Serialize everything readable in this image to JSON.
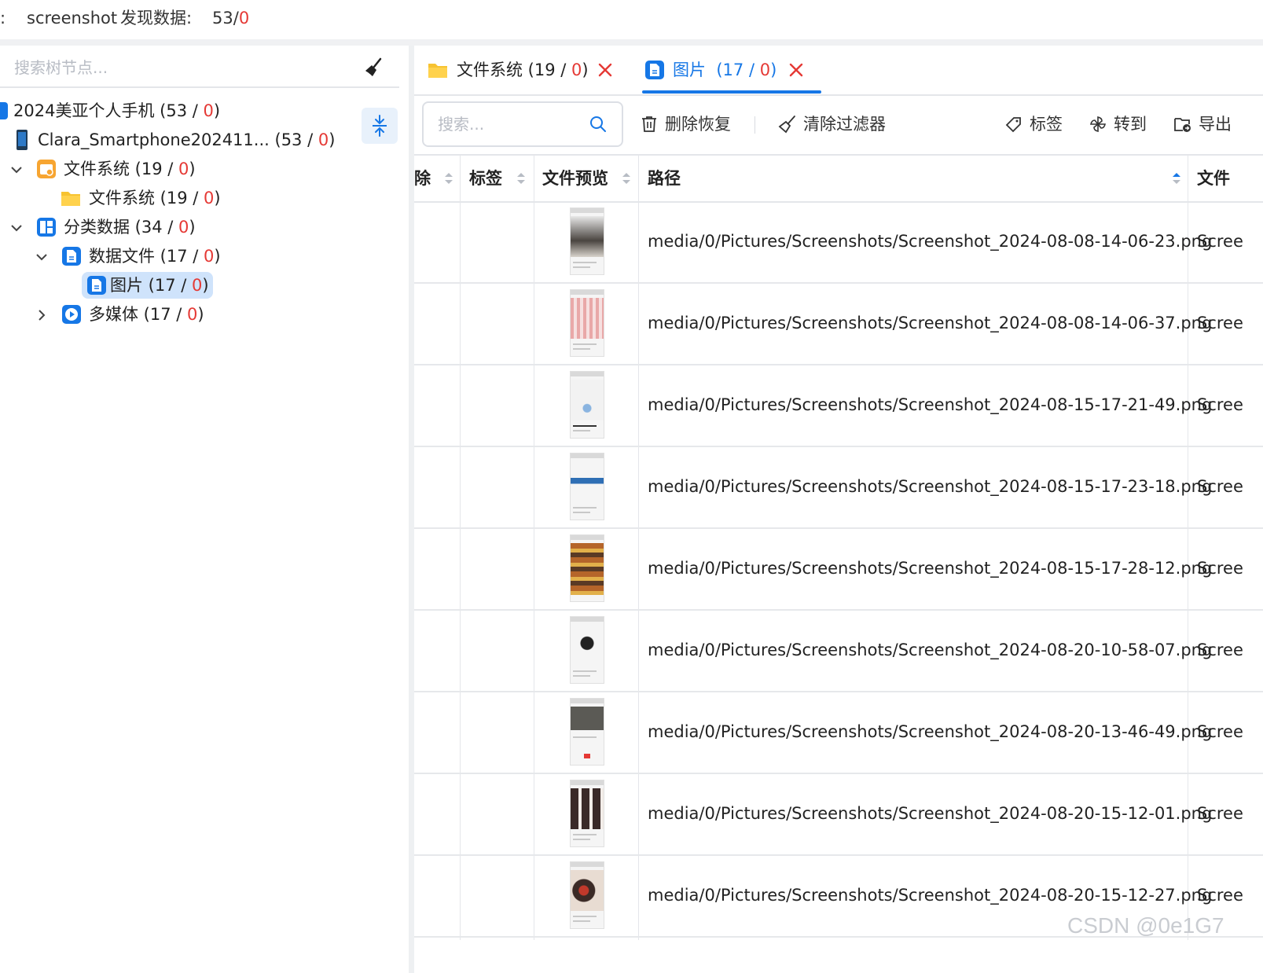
{
  "topbar": {
    "colon": ":",
    "title": "screenshot",
    "found_label": "发现数据:",
    "count": "53",
    "slash": "/",
    "bad": "0"
  },
  "tree": {
    "search_placeholder": "搜索树节点...",
    "nodes": [
      {
        "name": "2024美亚个人手机",
        "count": "53",
        "bad": "0"
      },
      {
        "name": "Clara_Smartphone202411...",
        "count": "53",
        "bad": "0"
      },
      {
        "name": "文件系统",
        "count": "19",
        "bad": "0"
      },
      {
        "name": "文件系统",
        "count": "19",
        "bad": "0"
      },
      {
        "name": "分类数据",
        "count": "34",
        "bad": "0"
      },
      {
        "name": "数据文件",
        "count": "17",
        "bad": "0"
      },
      {
        "name": "图片",
        "count": "17",
        "bad": "0"
      },
      {
        "name": "多媒体",
        "count": "17",
        "bad": "0"
      }
    ]
  },
  "tabs": [
    {
      "label": "文件系统",
      "count": "19",
      "bad": "0"
    },
    {
      "label": "图片",
      "count": "17",
      "bad": "0"
    }
  ],
  "toolbar": {
    "search_placeholder": "搜索...",
    "delete_restore": "删除恢复",
    "clear_filter": "清除过滤器",
    "tag": "标签",
    "goto": "转到",
    "export": "导出"
  },
  "table": {
    "columns": {
      "deleted": "除",
      "tag": "标签",
      "preview": "文件预览",
      "path": "路径",
      "filename": "文件"
    },
    "rows": [
      {
        "path": "media/0/Pictures/Screenshots/Screenshot_2024-08-08-14-06-23.png",
        "type": "Scree"
      },
      {
        "path": "media/0/Pictures/Screenshots/Screenshot_2024-08-08-14-06-37.png",
        "type": "Scree"
      },
      {
        "path": "media/0/Pictures/Screenshots/Screenshot_2024-08-15-17-21-49.png",
        "type": "Scree"
      },
      {
        "path": "media/0/Pictures/Screenshots/Screenshot_2024-08-15-17-23-18.png",
        "type": "Scree"
      },
      {
        "path": "media/0/Pictures/Screenshots/Screenshot_2024-08-15-17-28-12.png",
        "type": "Scree"
      },
      {
        "path": "media/0/Pictures/Screenshots/Screenshot_2024-08-20-10-58-07.png",
        "type": "Scree"
      },
      {
        "path": "media/0/Pictures/Screenshots/Screenshot_2024-08-20-13-46-49.png",
        "type": "Scree"
      },
      {
        "path": "media/0/Pictures/Screenshots/Screenshot_2024-08-20-15-12-01.png",
        "type": "Scree"
      },
      {
        "path": "media/0/Pictures/Screenshots/Screenshot_2024-08-20-15-12-27.png",
        "type": "Scree"
      }
    ]
  },
  "watermark": "CSDN @0e1G7",
  "colors": {
    "accent": "#1677e6",
    "error": "#e53935",
    "folder": "#f7b731"
  }
}
